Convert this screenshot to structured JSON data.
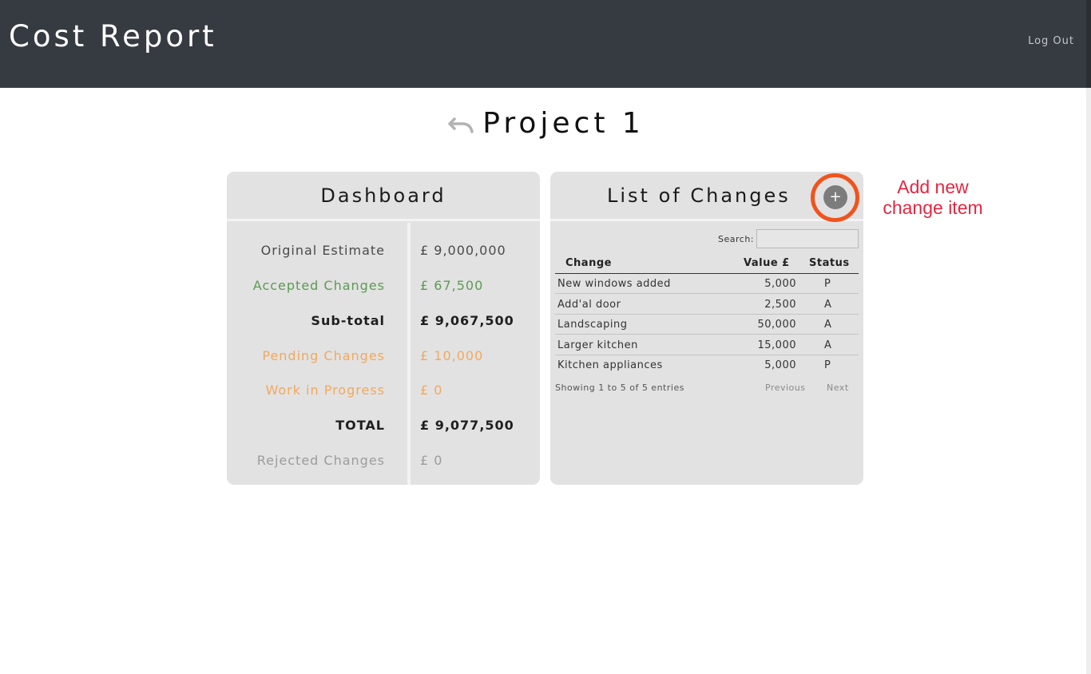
{
  "header": {
    "title": "Cost Report",
    "logout_label": "Log Out"
  },
  "project": {
    "title": "Project 1",
    "back_icon": "undo-arrow-icon"
  },
  "dashboard": {
    "title": "Dashboard",
    "rows": [
      {
        "label": "Original Estimate",
        "value": "£ 9,000,000",
        "color": "#4a4a4a"
      },
      {
        "label": "Accepted Changes",
        "value": "£ 67,500",
        "color": "#5c9a52"
      },
      {
        "label": "Sub-total",
        "value": "£ 9,067,500",
        "color": "#1f1f1f"
      },
      {
        "label": "Pending Changes",
        "value": "£ 10,000",
        "color": "#f2a85d"
      },
      {
        "label": "Work in Progress",
        "value": "£ 0",
        "color": "#f2a85d"
      },
      {
        "label": "TOTAL",
        "value": "£ 9,077,500",
        "color": "#1f1f1f"
      },
      {
        "label": "Rejected Changes",
        "value": "£ 0",
        "color": "#9c9c9c"
      }
    ]
  },
  "changes": {
    "title": "List of Changes",
    "add_button_label": "+",
    "search_label": "Search:",
    "search_value": "",
    "columns": [
      "Change",
      "Value £",
      "Status"
    ],
    "rows": [
      {
        "change": "New windows added",
        "value": "5,000",
        "status": "P"
      },
      {
        "change": "Add'al door",
        "value": "2,500",
        "status": "A"
      },
      {
        "change": "Landscaping",
        "value": "50,000",
        "status": "A"
      },
      {
        "change": "Larger kitchen",
        "value": "15,000",
        "status": "A"
      },
      {
        "change": "Kitchen appliances",
        "value": "5,000",
        "status": "P"
      }
    ],
    "info": "Showing 1 to 5 of 5 entries",
    "previous_label": "Previous",
    "next_label": "Next"
  },
  "annotation": {
    "callout_line1": "Add new",
    "callout_line2": "change item",
    "ring_color": "#f0541e",
    "text_color": "#e8253f"
  }
}
